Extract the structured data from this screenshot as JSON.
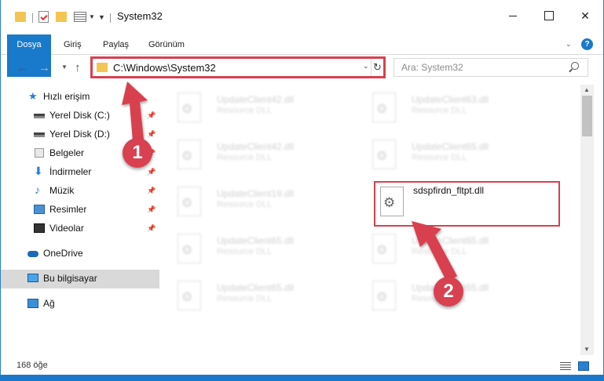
{
  "window": {
    "title": "System32"
  },
  "ribbon": {
    "tabs": [
      "Dosya",
      "Giriş",
      "Paylaş",
      "Görünüm"
    ],
    "help": "?"
  },
  "address": {
    "path": "C:\\Windows\\System32"
  },
  "search": {
    "placeholder": "Ara: System32"
  },
  "sidebar": {
    "items": [
      {
        "label": "Hızlı erişim",
        "icon": "star-icon"
      },
      {
        "label": "Yerel Disk (C:)",
        "icon": "disk-icon"
      },
      {
        "label": "Yerel Disk (D:)",
        "icon": "disk-icon"
      },
      {
        "label": "Belgeler",
        "icon": "documents-icon"
      },
      {
        "label": "İndirmeler",
        "icon": "downloads-icon"
      },
      {
        "label": "Müzik",
        "icon": "music-icon"
      },
      {
        "label": "Resimler",
        "icon": "pictures-icon"
      },
      {
        "label": "Videolar",
        "icon": "videos-icon"
      },
      {
        "label": "OneDrive",
        "icon": "onedrive-icon"
      },
      {
        "label": "Bu bilgisayar",
        "icon": "computer-icon"
      },
      {
        "label": "Ağ",
        "icon": "network-icon"
      }
    ]
  },
  "files": [
    {
      "name": "UpdateClient42.dll",
      "type": "Resource DLL"
    },
    {
      "name": "UpdateClient63.dll",
      "type": "Resource DLL"
    },
    {
      "name": "UpdateClient42.dll",
      "type": "Resource DLL"
    },
    {
      "name": "UpdateClient65.dll",
      "type": "Resource DLL"
    },
    {
      "name": "UpdateClient19.dll",
      "type": "Resource DLL"
    },
    {
      "name": "UpdateClient65.dll",
      "type": "Resource DLL"
    },
    {
      "name": "UpdateClient65.dll",
      "type": "Resource DLL"
    },
    {
      "name": "UpdateClient65.dll",
      "type": "Resource DLL"
    },
    {
      "name": "UpdateClient65.dll",
      "type": "Resource DLL"
    }
  ],
  "target_file": {
    "name": "sdspfirdn_fltpt.dll"
  },
  "status": {
    "count": "168 öğe"
  },
  "annotations": {
    "step1": "1",
    "step2": "2",
    "color": "#d94050"
  }
}
